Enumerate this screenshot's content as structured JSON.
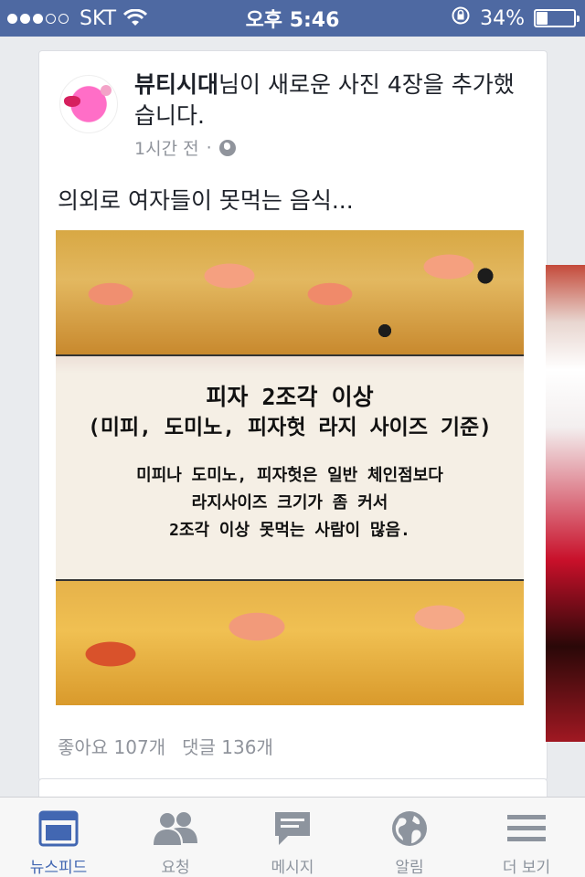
{
  "status_bar": {
    "carrier": "SKT",
    "time": "오후 5:46",
    "battery_percent": "34%",
    "battery_level": 0.34,
    "signal_bars_filled": 3,
    "signal_bars_total": 5
  },
  "post": {
    "author": "뷰티시대",
    "headline_rest": "님이 새로운 사진 4장을 추가했습니다.",
    "time": "1시간 전",
    "dot": "·",
    "text": "의외로 여자들이 못먹는 음식...",
    "photo": {
      "title": "피자 2조각 이상",
      "subtitle": "(미피, 도미노, 피자헛 라지 사이즈 기준)",
      "body_lines": [
        "미피나 도미노, 피자헛은 일반 체인점보다",
        "라지사이즈 크기가 좀 커서",
        "2조각 이상 못먹는 사람이 많음."
      ]
    },
    "likes": "좋아요 107개",
    "comments": "댓글 136개"
  },
  "tab_bar": {
    "tabs": [
      {
        "label": "뉴스피드",
        "icon": "news-feed-icon",
        "active": true
      },
      {
        "label": "요청",
        "icon": "friend-requests-icon",
        "active": false
      },
      {
        "label": "메시지",
        "icon": "messages-icon",
        "active": false
      },
      {
        "label": "알림",
        "icon": "globe-icon",
        "active": false
      },
      {
        "label": "더 보기",
        "icon": "menu-icon",
        "active": false
      }
    ]
  },
  "colors": {
    "status_bar_bg": "#4e69a2",
    "active_tab": "#4267b2",
    "inactive_tab": "#8d949e",
    "secondary_text": "#90949c"
  }
}
